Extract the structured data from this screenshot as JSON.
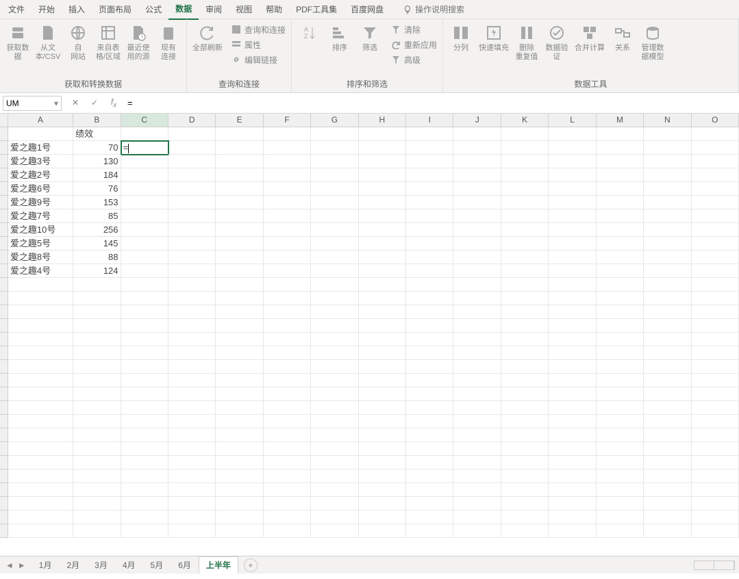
{
  "tabs": {
    "file": "文件",
    "home": "开始",
    "insert": "插入",
    "layout": "页面布局",
    "formulas": "公式",
    "data": "数据",
    "review": "审阅",
    "view": "视图",
    "help": "帮助",
    "pdf": "PDF工具集",
    "baidu": "百度网盘",
    "tell_me": "操作说明搜索",
    "active": "data"
  },
  "ribbon": {
    "group1": {
      "label": "获取和转换数据",
      "get_data": "获取数\n据",
      "from_csv": "从文\n本/CSV",
      "from_web": "自\n网站",
      "from_table": "来自表\n格/区域",
      "recent": "最近使\n用的源",
      "existing": "现有\n连接"
    },
    "group2": {
      "label": "查询和连接",
      "refresh_all": "全部刷新",
      "queries": "查询和连接",
      "props": "属性",
      "edit_links": "编辑链接"
    },
    "group3": {
      "label": "排序和筛选",
      "sort": "排序",
      "filter": "筛选",
      "clear": "清除",
      "reapply": "重新应用",
      "advanced": "高级"
    },
    "group4": {
      "label": "数据工具",
      "text_to_cols": "分列",
      "flash_fill": "快速填充",
      "remove_dup": "删除\n重复值",
      "data_val": "数据验\n证",
      "consolidate": "合并计算",
      "relationships": "关系",
      "data_model": "管理数\n据模型"
    }
  },
  "formula_bar": {
    "name_box": "UM",
    "formula": "="
  },
  "columns": [
    "A",
    "B",
    "C",
    "D",
    "E",
    "F",
    "G",
    "H",
    "I",
    "J",
    "K",
    "L",
    "M",
    "N",
    "O"
  ],
  "active_cell": "C2",
  "cell_edit_value": "=",
  "data_rows": [
    {
      "a": "",
      "b": "绩效"
    },
    {
      "a": "爱之趣1号",
      "b": "70"
    },
    {
      "a": "爱之趣3号",
      "b": "130"
    },
    {
      "a": "爱之趣2号",
      "b": "184"
    },
    {
      "a": "爱之趣6号",
      "b": "76"
    },
    {
      "a": "爱之趣9号",
      "b": "153"
    },
    {
      "a": "爱之趣7号",
      "b": "85"
    },
    {
      "a": "爱之趣10号",
      "b": "256"
    },
    {
      "a": "爱之趣5号",
      "b": "145"
    },
    {
      "a": "爱之趣8号",
      "b": "88"
    },
    {
      "a": "爱之趣4号",
      "b": "124"
    }
  ],
  "sheets": {
    "items": [
      "1月",
      "2月",
      "3月",
      "4月",
      "5月",
      "6月",
      "上半年"
    ],
    "active": "上半年"
  }
}
